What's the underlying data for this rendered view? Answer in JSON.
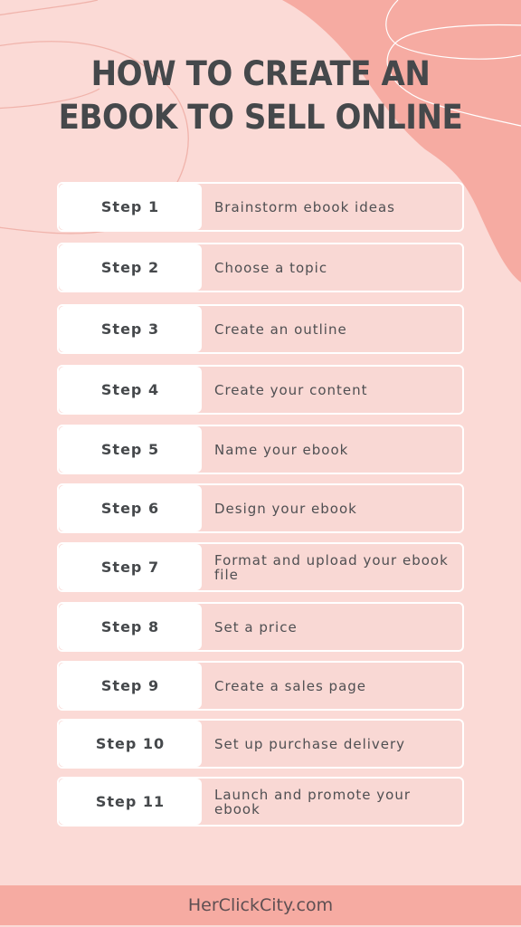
{
  "colors": {
    "background": "#fbdad6",
    "accent_blob": "#f6aba2",
    "card_fill": "#f9d8d4",
    "label_fill": "#ffffff",
    "title_text": "#45484b",
    "footer_bar": "#f6aba2"
  },
  "header": {
    "title_line_1": "HOW TO CREATE AN",
    "title_line_2": "EBOOK TO SELL ONLINE"
  },
  "steps": [
    {
      "label": "Step 1",
      "text": "Brainstorm ebook ideas"
    },
    {
      "label": "Step 2",
      "text": "Choose a topic"
    },
    {
      "label": "Step 3",
      "text": "Create an outline"
    },
    {
      "label": "Step 4",
      "text": "Create your content"
    },
    {
      "label": "Step 5",
      "text": "Name your ebook"
    },
    {
      "label": "Step 6",
      "text": "Design your ebook"
    },
    {
      "label": "Step 7",
      "text": "Format and upload your ebook file"
    },
    {
      "label": "Step 8",
      "text": "Set a price"
    },
    {
      "label": "Step 9",
      "text": "Create a sales page"
    },
    {
      "label": "Step 10",
      "text": "Set up purchase delivery"
    },
    {
      "label": "Step 11",
      "text": "Launch and promote your ebook"
    }
  ],
  "footer": {
    "site": "HerClickCity.com"
  }
}
